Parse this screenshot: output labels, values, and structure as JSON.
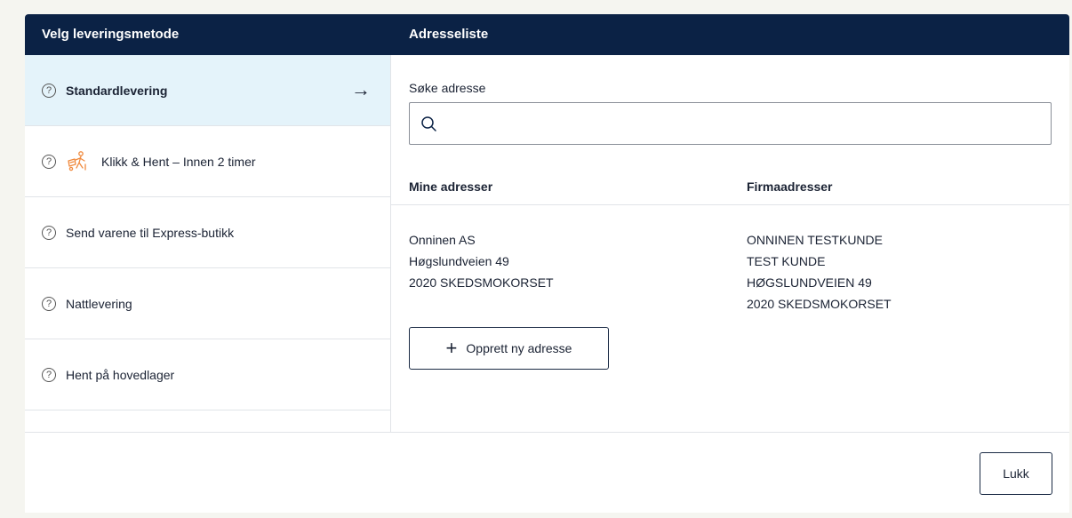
{
  "header": {
    "left_title": "Velg leveringsmetode",
    "right_title": "Adresseliste"
  },
  "methods": [
    {
      "label": "Standardlevering",
      "active": true
    },
    {
      "label": "Klikk & Hent – Innen 2 timer",
      "icon": "person-pickup-icon",
      "icon_color": "#f08a3e"
    },
    {
      "label": "Send varene til Express-butikk"
    },
    {
      "label": "Nattlevering"
    },
    {
      "label": "Hent på hovedlager"
    }
  ],
  "search": {
    "label": "Søke adresse",
    "placeholder": "",
    "value": ""
  },
  "columns": {
    "mine": "Mine adresser",
    "firma": "Firmaadresser"
  },
  "mine_address": [
    "Onninen AS",
    "Høgslundveien 49",
    "2020 SKEDSMOKORSET"
  ],
  "firma_address": [
    "ONNINEN TESTKUNDE",
    "TEST KUNDE",
    "HØGSLUNDVEIEN 49",
    "2020 SKEDSMOKORSET"
  ],
  "new_address_button": "Opprett ny adresse",
  "close_button": "Lukk",
  "colors": {
    "header_bg": "#0b2245",
    "active_bg": "#e4f3fa",
    "accent_orange": "#f08a3e"
  }
}
